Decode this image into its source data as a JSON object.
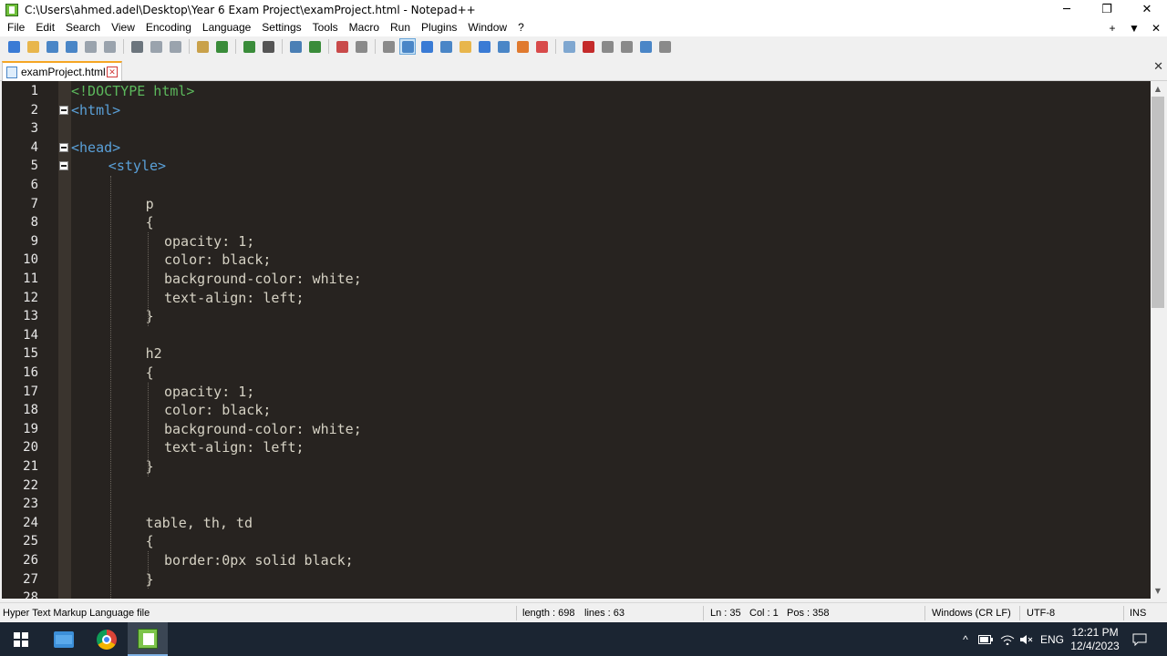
{
  "window": {
    "title": "C:\\Users\\ahmed.adel\\Desktop\\Year 6 Exam Project\\examProject.html - Notepad++",
    "minimize": "─",
    "restore": "❐",
    "close": "✕"
  },
  "menu": {
    "items": [
      "File",
      "Edit",
      "Search",
      "View",
      "Encoding",
      "Language",
      "Settings",
      "Tools",
      "Macro",
      "Run",
      "Plugins",
      "Window",
      "?"
    ],
    "right_plus": "+",
    "right_down": "▼",
    "right_close": "✕"
  },
  "toolbar": {
    "icons": [
      "new-file-icon",
      "open-file-icon",
      "save-icon",
      "save-all-icon",
      "close-icon",
      "close-all-icon",
      "print-icon",
      "cut-icon",
      "copy-icon",
      "paste-icon",
      "undo-icon",
      "redo-icon",
      "find-icon",
      "replace-icon",
      "zoom-in-icon",
      "zoom-out-icon",
      "sync-vertical-icon",
      "sync-horizontal-icon",
      "word-wrap-icon",
      "show-all-chars-icon",
      "indent-guide-icon",
      "user-defined-lang-icon",
      "doc-map-icon",
      "doc-list-icon",
      "function-list-icon",
      "folder-workspace-icon",
      "monitoring-icon",
      "record-macro-icon",
      "stop-record-icon",
      "play-macro-icon",
      "run-macro-multiple-icon",
      "save-macro-icon"
    ],
    "colors": [
      "#3a7bd5",
      "#e8b64c",
      "#4a86c7",
      "#4a86c7",
      "#9aa3ad",
      "#9aa3ad",
      "#6c757d",
      "#9aa3ad",
      "#9aa3ad",
      "#c9a14a",
      "#3a8c3a",
      "#3a8c3a",
      "#555555",
      "#4a7fb5",
      "#3a8c3a",
      "#c94a4a",
      "#8a8a8a",
      "#8a8a8a",
      "#4a86c7",
      "#3a7bd5",
      "#4a86c7",
      "#e8b64c",
      "#3a7bd5",
      "#4a86c7",
      "#e07a2f",
      "#d84a4a",
      "#7fa7d0",
      "#c42b2b",
      "#8a8a8a",
      "#8a8a8a",
      "#4a86c7",
      "#8a8a8a"
    ]
  },
  "tab": {
    "label": "examProject.html",
    "close": "✕",
    "close_all": "✕"
  },
  "editor": {
    "lines": [
      {
        "n": "1",
        "indent": 0,
        "parts": [
          {
            "t": "<!DOCTYPE html>",
            "c": "doctype"
          }
        ]
      },
      {
        "n": "2",
        "indent": 0,
        "fold": true,
        "parts": [
          {
            "t": "<html>",
            "c": "tag"
          }
        ]
      },
      {
        "n": "3",
        "indent": 0,
        "parts": []
      },
      {
        "n": "4",
        "indent": 0,
        "fold": true,
        "parts": [
          {
            "t": "<head>",
            "c": "tag"
          }
        ]
      },
      {
        "n": "5",
        "indent": 4,
        "fold": true,
        "parts": [
          {
            "t": "<style>",
            "c": "tag"
          }
        ]
      },
      {
        "n": "6",
        "indent": 0,
        "parts": []
      },
      {
        "n": "7",
        "indent": 8,
        "parts": [
          {
            "t": "p",
            "c": "plain"
          }
        ]
      },
      {
        "n": "8",
        "indent": 8,
        "parts": [
          {
            "t": "{",
            "c": "plain"
          }
        ]
      },
      {
        "n": "9",
        "indent": 10,
        "parts": [
          {
            "t": "opacity: 1;",
            "c": "plain"
          }
        ]
      },
      {
        "n": "10",
        "indent": 10,
        "parts": [
          {
            "t": "color: black;",
            "c": "plain"
          }
        ]
      },
      {
        "n": "11",
        "indent": 10,
        "parts": [
          {
            "t": "background-color: white;",
            "c": "plain"
          }
        ]
      },
      {
        "n": "12",
        "indent": 10,
        "parts": [
          {
            "t": "text-align: left;",
            "c": "plain"
          }
        ]
      },
      {
        "n": "13",
        "indent": 8,
        "parts": [
          {
            "t": "}",
            "c": "plain"
          }
        ]
      },
      {
        "n": "14",
        "indent": 0,
        "parts": []
      },
      {
        "n": "15",
        "indent": 8,
        "parts": [
          {
            "t": "h2",
            "c": "plain"
          }
        ]
      },
      {
        "n": "16",
        "indent": 8,
        "parts": [
          {
            "t": "{",
            "c": "plain"
          }
        ]
      },
      {
        "n": "17",
        "indent": 10,
        "parts": [
          {
            "t": "opacity: 1;",
            "c": "plain"
          }
        ]
      },
      {
        "n": "18",
        "indent": 10,
        "parts": [
          {
            "t": "color: black;",
            "c": "plain"
          }
        ]
      },
      {
        "n": "19",
        "indent": 10,
        "parts": [
          {
            "t": "background-color: white;",
            "c": "plain"
          }
        ]
      },
      {
        "n": "20",
        "indent": 10,
        "parts": [
          {
            "t": "text-align: left;",
            "c": "plain"
          }
        ]
      },
      {
        "n": "21",
        "indent": 8,
        "parts": [
          {
            "t": "}",
            "c": "plain"
          }
        ]
      },
      {
        "n": "22",
        "indent": 0,
        "parts": []
      },
      {
        "n": "23",
        "indent": 0,
        "parts": []
      },
      {
        "n": "24",
        "indent": 8,
        "parts": [
          {
            "t": "table, th, td",
            "c": "plain"
          }
        ]
      },
      {
        "n": "25",
        "indent": 8,
        "parts": [
          {
            "t": "{",
            "c": "plain"
          }
        ]
      },
      {
        "n": "26",
        "indent": 10,
        "parts": [
          {
            "t": "border:0px solid black;",
            "c": "plain"
          }
        ]
      },
      {
        "n": "27",
        "indent": 8,
        "parts": [
          {
            "t": "}",
            "c": "plain"
          }
        ]
      },
      {
        "n": "28",
        "indent": 0,
        "parts": []
      }
    ]
  },
  "status": {
    "file_type": "Hyper Text Markup Language file",
    "length": "length : 698",
    "lines": "lines : 63",
    "ln": "Ln : 35",
    "col": "Col : 1",
    "pos": "Pos : 358",
    "eol": "Windows (CR LF)",
    "encoding": "UTF-8",
    "ins": "INS"
  },
  "taskbar": {
    "tray_chevron": "^",
    "lang": "ENG",
    "time": "12:21 PM",
    "date": "12/4/2023"
  }
}
